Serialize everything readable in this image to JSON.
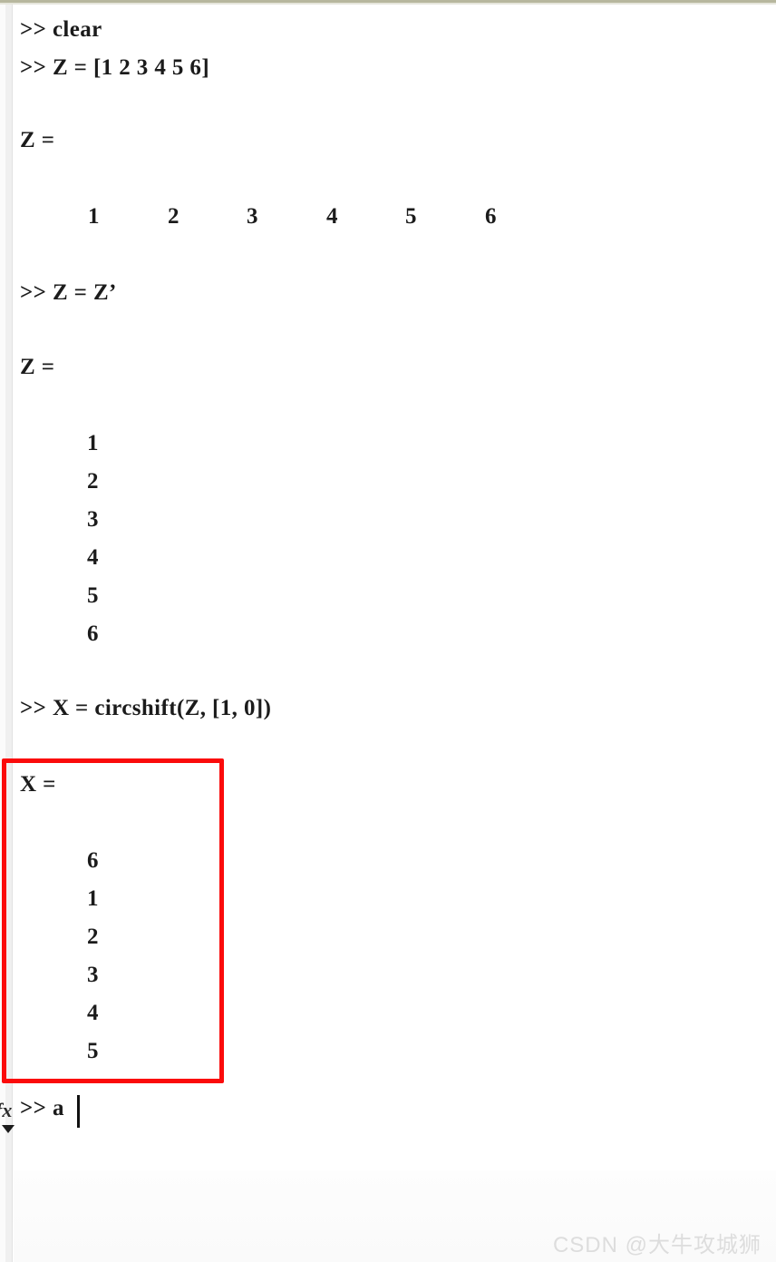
{
  "window": {
    "app": "MATLAB Command Window",
    "prompt_symbol": ">>"
  },
  "session": {
    "lines": [
      {
        "kind": "command",
        "text": ">> clear"
      },
      {
        "kind": "command",
        "text": ">> Z = [1 2 3 4 5 6]"
      },
      {
        "kind": "output",
        "text": "Z ="
      },
      {
        "kind": "command",
        "text": ">> Z = Z’"
      },
      {
        "kind": "output",
        "text": "Z ="
      },
      {
        "kind": "command",
        "text": ">> X = circshift(Z, [1, 0])"
      },
      {
        "kind": "output",
        "text": "X ="
      },
      {
        "kind": "command",
        "text": ">> a"
      }
    ],
    "commands": {
      "clear": ">> clear",
      "define_z": ">> Z = [1 2 3 4 5 6]",
      "transpose_z": ">> Z = Z’",
      "circshift_x": ">> X = circshift(Z, [1, 0])",
      "active_input": ">> a"
    },
    "labels": {
      "z_result_1": "Z =",
      "z_result_2": "Z =",
      "x_result": "X ="
    }
  },
  "results": {
    "z_row": [
      "1",
      "2",
      "3",
      "4",
      "5",
      "6"
    ],
    "z_column": [
      "1",
      "2",
      "3",
      "4",
      "5",
      "6"
    ],
    "x_column": [
      "6",
      "1",
      "2",
      "3",
      "4",
      "5"
    ]
  },
  "annotation": {
    "highlight_color": "#fb0b0b",
    "highlight_target": "X = result block"
  },
  "gutter": {
    "fx_label": "fx",
    "caret_symbol": "▼"
  },
  "watermark": {
    "text": "CSDN @大牛攻城狮",
    "color": "#dddddd"
  }
}
